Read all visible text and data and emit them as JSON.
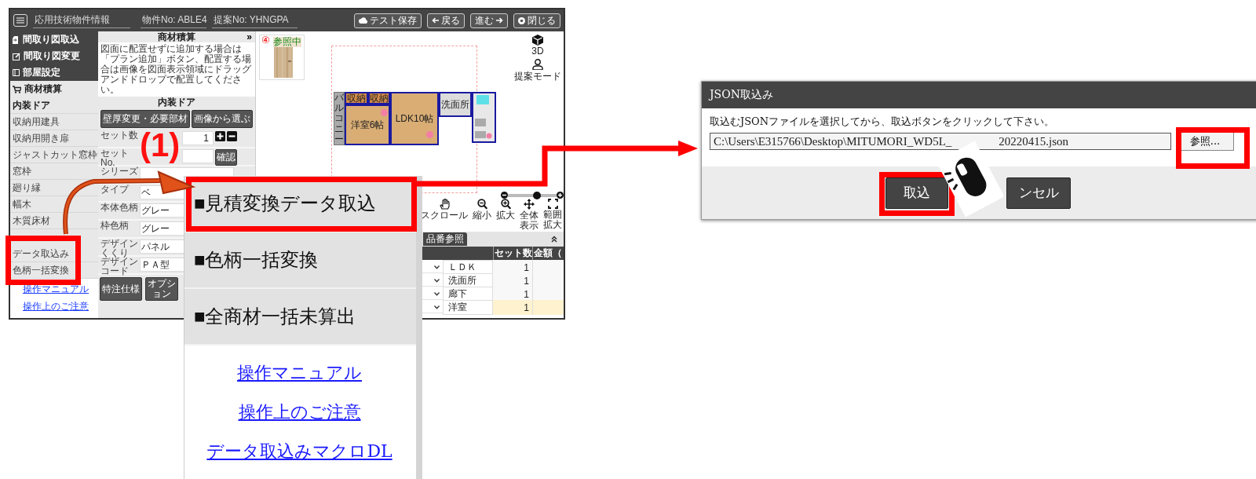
{
  "app": {
    "header": {
      "title": "応用技術物件情報",
      "property_no": "物件No: ABLE4",
      "proposal_no": "提案No: YHNGPA",
      "buttons": [
        "テスト保存",
        "戻る",
        "進む",
        "閉じる"
      ]
    },
    "sidebar": {
      "main_items": [
        {
          "label": "間取り図取込",
          "selected": false
        },
        {
          "label": "間取り図変更",
          "selected": false
        },
        {
          "label": "部屋設定",
          "selected": false
        },
        {
          "label": "商材積算",
          "selected": true
        }
      ],
      "sub_items": [
        {
          "label": "内装ドア",
          "selected": true
        },
        {
          "label": "収納用建具",
          "selected": false
        },
        {
          "label": "収納用開き扉",
          "selected": false
        },
        {
          "label": "ジャストカット窓枠",
          "selected": false
        },
        {
          "label": "窓枠",
          "selected": false
        },
        {
          "label": "廻り縁",
          "selected": false
        },
        {
          "label": "幅木",
          "selected": false
        },
        {
          "label": "木質床材",
          "selected": false
        }
      ],
      "tools": [
        "データ取込み",
        "色柄一括変換"
      ],
      "tools_highlighted": true,
      "links": [
        "操作マニュアル",
        "操作上のご注意"
      ]
    },
    "panel": {
      "title": "商材積算",
      "collapse": "»",
      "note": "図面に配置せずに追加する場合は「プラン追加」ボタン、配置する場合は画像を図面表示領域にドラッグアンドドロップで配置してください。",
      "section": "内装ドア",
      "top_buttons": [
        "壁厚変更・必要部材",
        "画像から選ぶ"
      ],
      "fields": [
        {
          "kind": "stepper",
          "label": "セット数",
          "value": "1"
        },
        {
          "kind": "confirm",
          "label": "セットNo.",
          "button": "確認"
        },
        {
          "kind": "select",
          "label": "シリーズ"
        },
        {
          "kind": "select",
          "label": "タイプ",
          "value": "ベ"
        },
        {
          "kind": "select",
          "label": "本体色柄",
          "value": "グレー"
        },
        {
          "kind": "select",
          "label": "枠色柄",
          "value": "グレー"
        },
        {
          "kind": "select",
          "label": "デザインくくり",
          "value": "パネル"
        },
        {
          "kind": "select",
          "label": "デザインコード",
          "value": "ＰＡ型"
        }
      ],
      "bottom_buttons": [
        "特注仕様",
        "オプション"
      ]
    },
    "canvas": {
      "thumbnail": {
        "number": "④",
        "status": "参照中"
      },
      "floor_plan": {
        "rooms": [
          {
            "kind": "balcony",
            "label": "バルコニー"
          },
          {
            "kind": "storage",
            "label": "収納"
          },
          {
            "kind": "storage",
            "label": "収納"
          },
          {
            "kind": "bedroom",
            "label": "洋室6帖"
          },
          {
            "kind": "ldk",
            "label": "LDK10帖"
          },
          {
            "kind": "washroom",
            "label": "洗面所"
          }
        ]
      },
      "view_buttons": [
        "3D",
        "提案モード"
      ],
      "zoom": {
        "level": 0.6
      },
      "tools": [
        "スクロール",
        "縮小",
        "拡大",
        "全体表示",
        "範囲拡大"
      ],
      "table": {
        "tab": "品番参照",
        "columns": [
          "セット数",
          "金額（"
        ],
        "rows": [
          {
            "room": "ＬＤＫ",
            "count": "1",
            "selected": false
          },
          {
            "room": "洗面所",
            "count": "1",
            "selected": false
          },
          {
            "room": "廊下",
            "count": "1",
            "selected": false
          },
          {
            "room": "洋室",
            "count": "1",
            "selected": true
          }
        ]
      }
    }
  },
  "step_label": "(1)",
  "popup": {
    "items": [
      {
        "label": "■見積変換データ取込",
        "highlighted": true
      },
      {
        "label": "■色柄一括変換",
        "highlighted": false
      },
      {
        "label": "■全商材一括未算出",
        "highlighted": false
      }
    ],
    "links": [
      "操作マニュアル",
      "操作上のご注意",
      "データ取込みマクロDL"
    ]
  },
  "dialog": {
    "title": "JSON取込み",
    "instruction": "取込むJSONファイルを選択してから、取込ボタンをクリックして下さい。",
    "path_start": "C:\\Users\\E315766\\Desktop\\MITUMORI_WD5L_",
    "path_end": "20220415.json",
    "browse": {
      "label": "参照...",
      "highlighted": true
    },
    "import": {
      "label": "取込",
      "highlighted": true
    },
    "cancel": {
      "label": "ンセル"
    }
  }
}
